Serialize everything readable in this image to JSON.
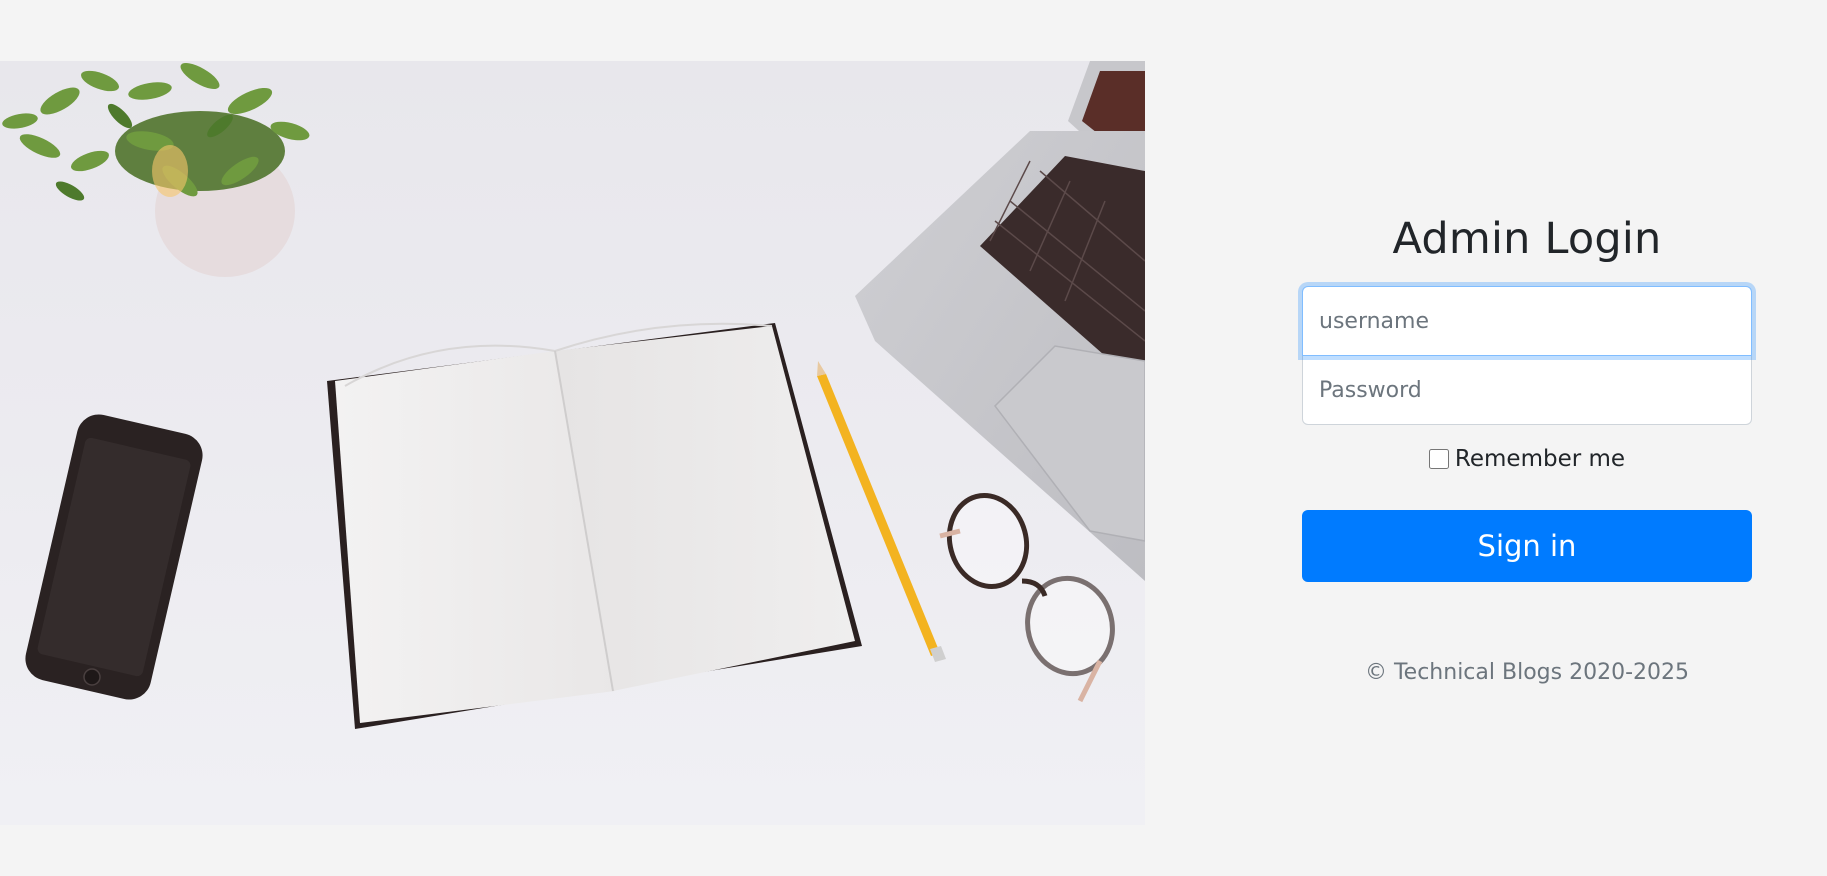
{
  "login": {
    "title": "Admin Login",
    "username_placeholder": "username",
    "password_placeholder": "Password",
    "remember_label": "Remember me",
    "remember_checked": false,
    "signin_label": "Sign in",
    "footer": "© Technical Blogs 2020-2025"
  },
  "colors": {
    "background": "#f4f4f4",
    "primary_button": "#007bff",
    "focus_border": "#80bdff",
    "text_dark": "#212529",
    "text_muted": "#6c757d"
  }
}
